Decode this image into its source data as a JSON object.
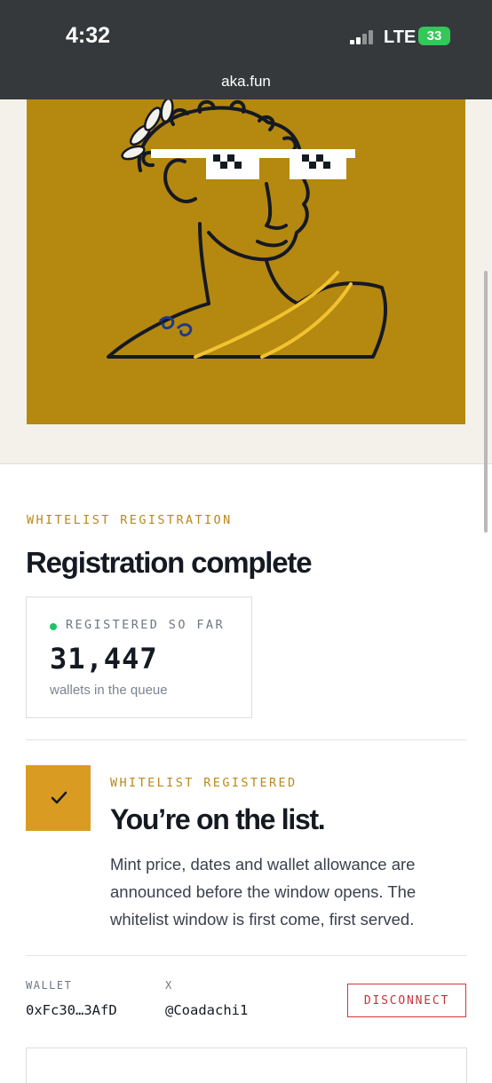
{
  "status_bar": {
    "time": "4:32",
    "network": "LTE",
    "battery": "33"
  },
  "browser": {
    "url": "aka.fun"
  },
  "hero": {
    "image_name": "statue-bust-with-pixel-sunglasses",
    "background_color": "#b58810"
  },
  "registration": {
    "eyebrow": "WHITELIST REGISTRATION",
    "title": "Registration complete",
    "stat": {
      "label": "REGISTERED SO FAR",
      "value": "31,447",
      "caption": "wallets in the queue",
      "status_color": "#1cc36a"
    }
  },
  "confirmation": {
    "eyebrow": "WHITELIST REGISTERED",
    "title": "You’re on the list.",
    "body": "Mint price, dates and wallet allowance are announced before the window opens. The whitelist window is first come, first served."
  },
  "account": {
    "wallet_label": "WALLET",
    "wallet_value": "0xFc30…3AfD",
    "x_label": "X",
    "x_value": "@Coadachi1",
    "disconnect_label": "DISCONNECT"
  },
  "colors": {
    "accent": "#b9891a",
    "check_fill": "#d99b21",
    "danger": "#d0363d",
    "text": "#151922"
  }
}
